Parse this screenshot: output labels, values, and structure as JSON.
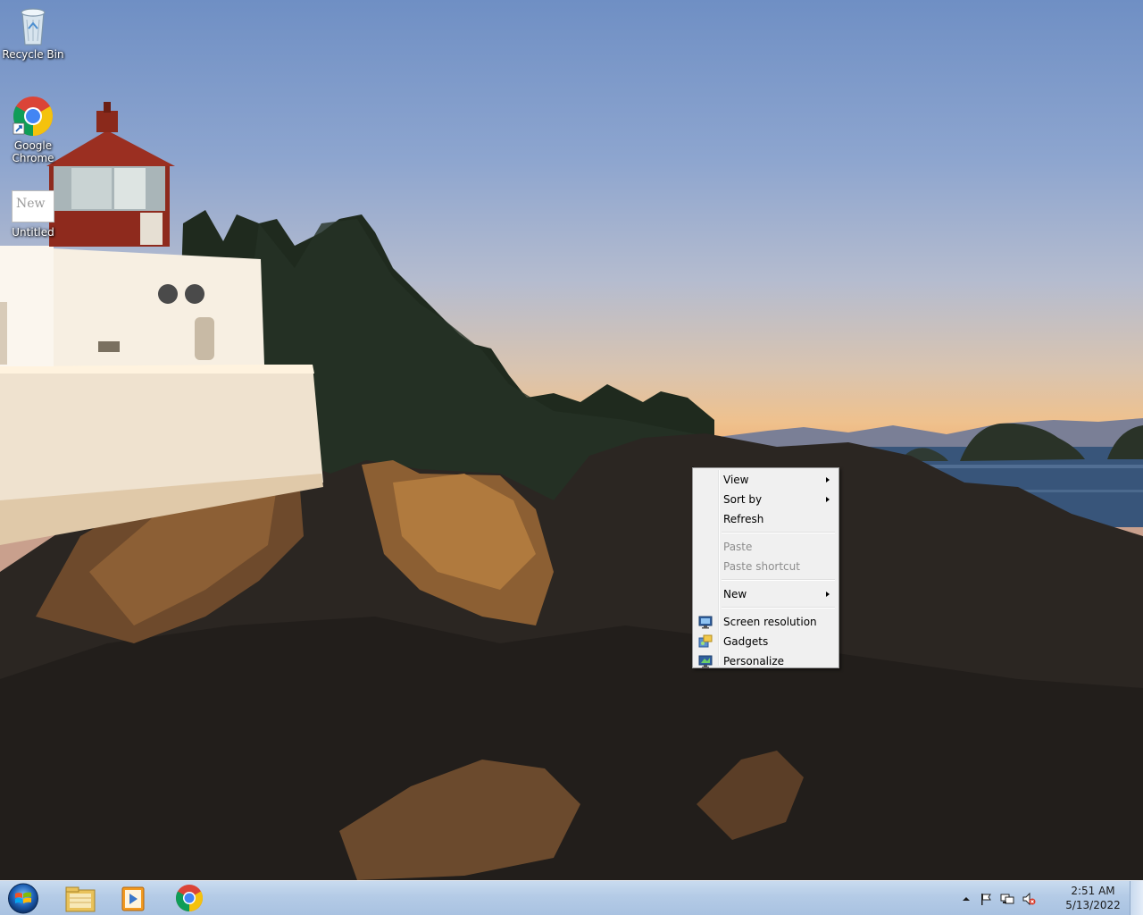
{
  "desktop": {
    "icons": [
      {
        "label": "Recycle Bin",
        "icon": "recycle-bin-icon"
      },
      {
        "label": "Google Chrome",
        "icon": "chrome-icon"
      },
      {
        "label": "Untitled",
        "icon": "document-icon",
        "thumb_text": "New"
      }
    ]
  },
  "context_menu": {
    "view": "View",
    "sort_by": "Sort by",
    "refresh": "Refresh",
    "paste": "Paste",
    "paste_shortcut": "Paste shortcut",
    "new": "New",
    "screen_resolution": "Screen resolution",
    "gadgets": "Gadgets",
    "personalize": "Personalize"
  },
  "taskbar": {
    "pinned": [
      "windows-explorer-icon",
      "media-player-icon",
      "chrome-icon"
    ],
    "clock": {
      "time": "2:51 AM",
      "date": "5/13/2022"
    },
    "tray_icons": [
      "show-hidden-icons-icon",
      "action-center-flag-icon",
      "network-icon",
      "volume-muted-icon"
    ]
  },
  "colors": {
    "taskbar": "#b4cbe6",
    "menu_bg": "#f0f0f0",
    "menu_disabled_text": "#8d8d8d"
  }
}
